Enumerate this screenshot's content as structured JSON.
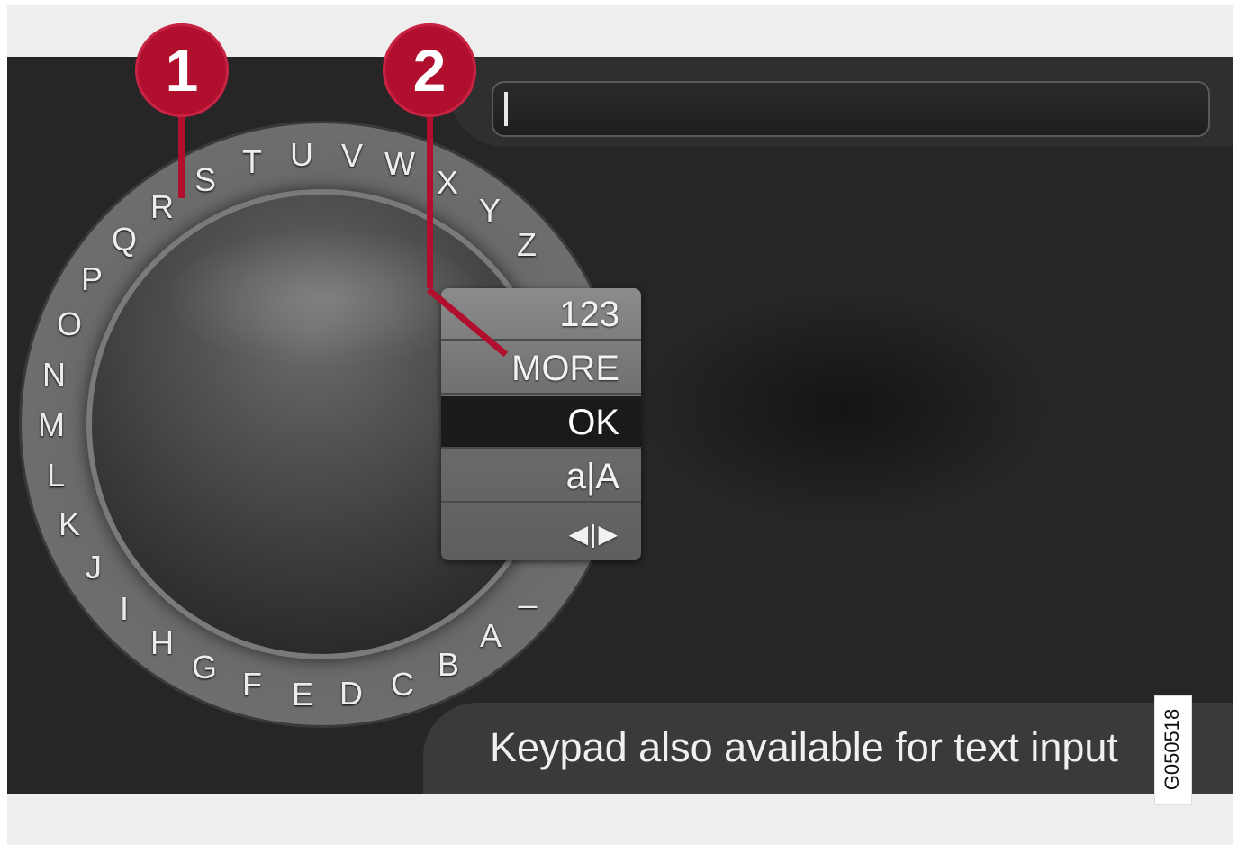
{
  "input_field": {
    "value": ""
  },
  "wheel": {
    "letters": [
      "A",
      "B",
      "C",
      "D",
      "E",
      "F",
      "G",
      "H",
      "I",
      "J",
      "K",
      "L",
      "M",
      "N",
      "O",
      "P",
      "Q",
      "R",
      "S",
      "T",
      "U",
      "V",
      "W",
      "X",
      "Y",
      "Z",
      "_"
    ]
  },
  "menu": {
    "items": [
      {
        "label": "123"
      },
      {
        "label": "MORE"
      },
      {
        "label": "OK",
        "selected": true
      },
      {
        "label": "a|A"
      },
      {
        "label": "◀|▶"
      }
    ]
  },
  "footer": {
    "hint": "Keypad also available for text input"
  },
  "image_code": "G050518",
  "callouts": [
    "1",
    "2"
  ],
  "colors": {
    "callout": "#b0102e",
    "screen_bg": "#262626"
  }
}
